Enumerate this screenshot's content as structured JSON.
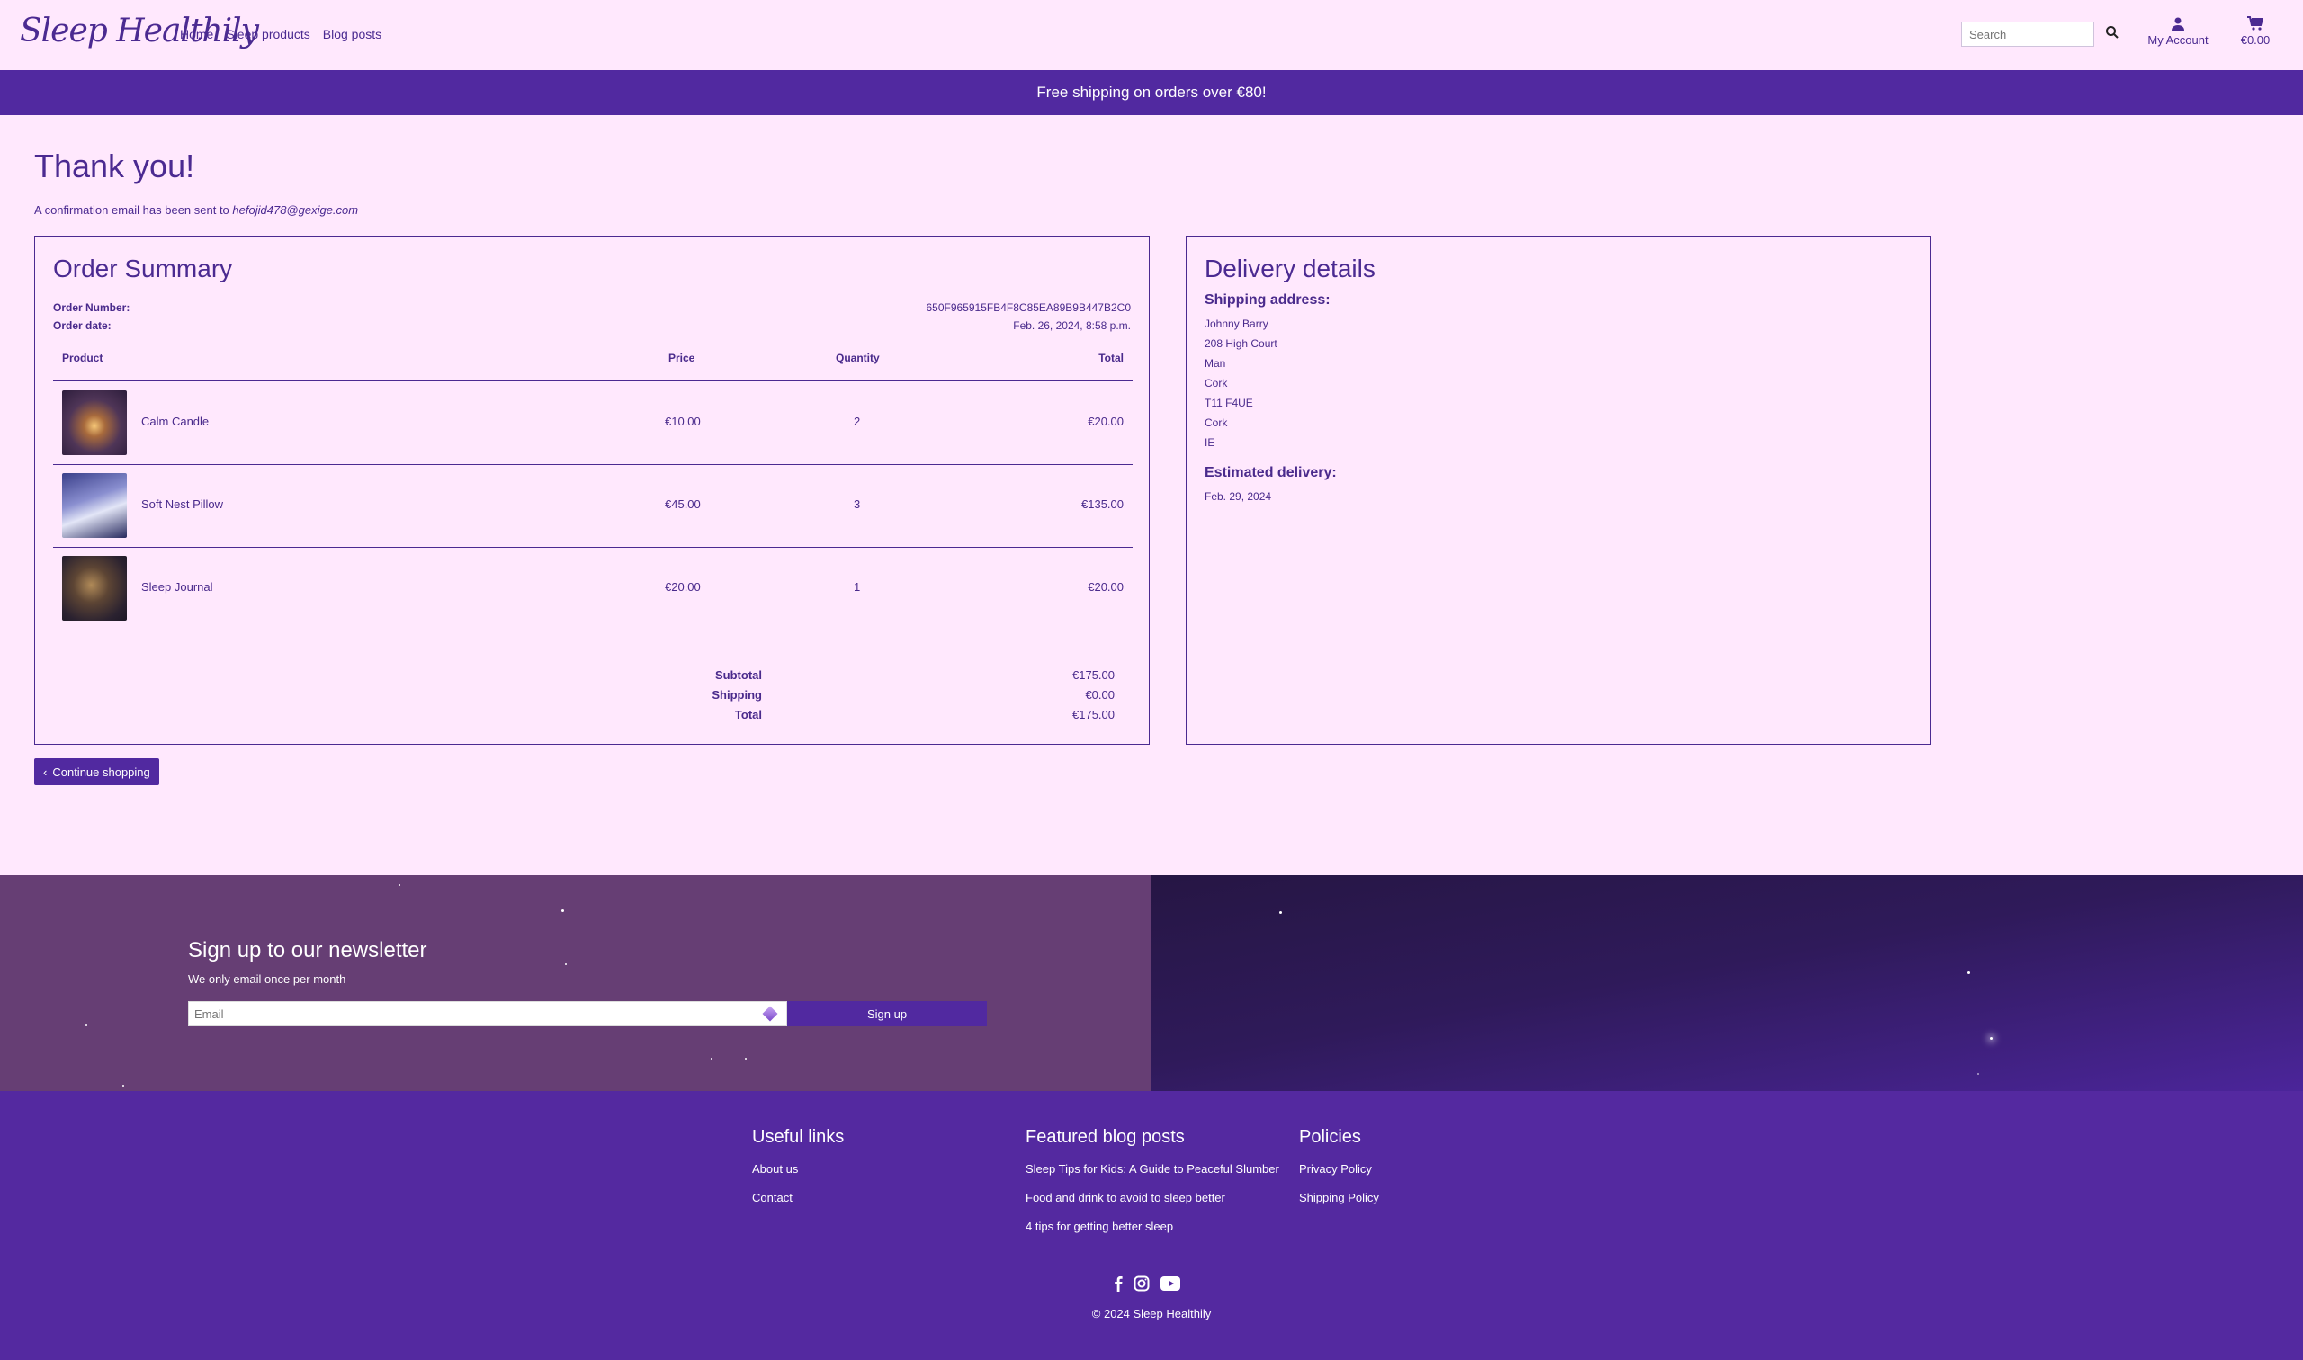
{
  "nav": {
    "logo": "Sleep Healthily",
    "links": [
      "Home",
      "Sleep products",
      "Blog posts"
    ],
    "search_placeholder": "Search",
    "account_label": "My Account",
    "cart_total": "€0.00"
  },
  "banner": {
    "text": "Free shipping on orders over €80!"
  },
  "page": {
    "title": "Thank you!",
    "confirm_text": "A confirmation email has been sent to",
    "email": "hefojid478@gexige.com",
    "continue_label": "Continue shopping"
  },
  "order": {
    "title": "Order Summary",
    "number_label": "Order Number:",
    "number": "650F965915FB4F8C85EA89B9B447B2C0",
    "date_label": "Order date:",
    "date": "Feb. 26, 2024, 8:58 p.m.",
    "columns": [
      "Product",
      "Price",
      "Quantity",
      "Total"
    ],
    "items": [
      {
        "name": "Calm Candle",
        "price": "€10.00",
        "qty": "2",
        "total": "€20.00"
      },
      {
        "name": "Soft Nest Pillow",
        "price": "€45.00",
        "qty": "3",
        "total": "€135.00"
      },
      {
        "name": "Sleep Journal",
        "price": "€20.00",
        "qty": "1",
        "total": "€20.00"
      }
    ],
    "subtotal_label": "Subtotal",
    "subtotal": "€175.00",
    "shipping_label": "Shipping",
    "shipping": "€0.00",
    "total_label": "Total",
    "total": "€175.00"
  },
  "delivery": {
    "title": "Delivery details",
    "shipping_label": "Shipping address:",
    "address": [
      "Johnny Barry",
      "208 High Court",
      "Man",
      "Cork",
      "T11 F4UE",
      "Cork",
      "IE"
    ],
    "estimated_label": "Estimated delivery:",
    "estimated": "Feb. 29, 2024"
  },
  "newsletter": {
    "title": "Sign up to our newsletter",
    "subtitle": "We only email once per month",
    "email_placeholder": "Email",
    "button": "Sign up"
  },
  "footer": {
    "useful_title": "Useful links",
    "useful_links": [
      "About us",
      "Contact"
    ],
    "blog_title": "Featured blog posts",
    "blog_links": [
      "Sleep Tips for Kids: A Guide to Peaceful Slumber",
      "Food and drink to avoid to sleep better",
      "4 tips for getting better sleep"
    ],
    "policies_title": "Policies",
    "policy_links": [
      "Privacy Policy",
      "Shipping Policy"
    ],
    "copyright": "© 2024 Sleep Healthily"
  },
  "colors": {
    "brand": "#5129a0",
    "background": "#ffe8fd",
    "text": "#4b2a91"
  }
}
